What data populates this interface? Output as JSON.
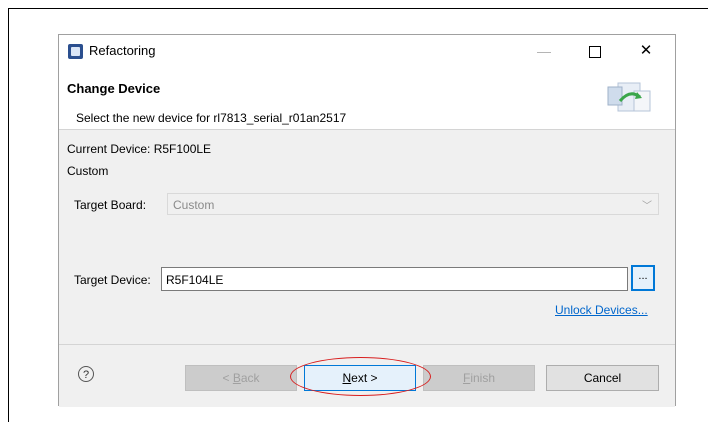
{
  "window": {
    "title": "Refactoring",
    "min_glyph": "—",
    "close_glyph": "✕"
  },
  "header": {
    "title": "Change Device",
    "description": "Select the new device for rl7813_serial_r01an2517"
  },
  "content": {
    "current_device": "Current Device: R5F100LE",
    "current_board": "Custom",
    "target_board_label": "Target Board:",
    "target_board_value": "Custom",
    "target_device_label": "Target Device:",
    "target_device_value": "R5F104LE",
    "browse_label": "...",
    "unlock_link": "Unlock Devices..."
  },
  "footer": {
    "help_glyph": "?",
    "back_prefix": "< ",
    "back_mnemonic": "B",
    "back_rest": "ack",
    "next_mnemonic": "N",
    "next_rest": "ext >",
    "finish_mnemonic": "F",
    "finish_rest": "inish",
    "cancel_label": "Cancel"
  },
  "colors": {
    "highlight_circle": "#d81e1e",
    "link": "#0066cc",
    "focus_border": "#0078d7"
  }
}
